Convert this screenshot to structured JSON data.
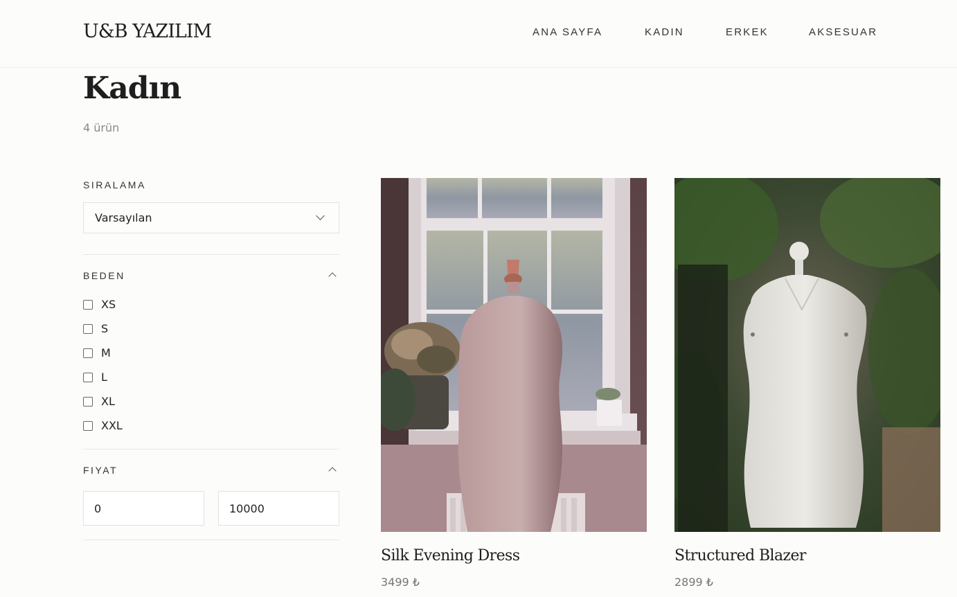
{
  "header": {
    "logo": "U&B YAZILIM",
    "nav": [
      {
        "label": "ANA SAYFA"
      },
      {
        "label": "KADIN"
      },
      {
        "label": "ERKEK"
      },
      {
        "label": "AKSESUAR"
      }
    ]
  },
  "page": {
    "title": "Kadın",
    "count": "4 ürün"
  },
  "filters": {
    "sort": {
      "label": "SIRALAMA",
      "selected": "Varsayılan"
    },
    "size": {
      "label": "BEDEN",
      "options": [
        "XS",
        "S",
        "M",
        "L",
        "XL",
        "XXL"
      ]
    },
    "price": {
      "label": "FIYAT",
      "min": "0",
      "max": "10000"
    }
  },
  "products": [
    {
      "name": "Silk Evening Dress",
      "price": "3499 ₺"
    },
    {
      "name": "Structured Blazer",
      "price": "2899 ₺"
    }
  ]
}
